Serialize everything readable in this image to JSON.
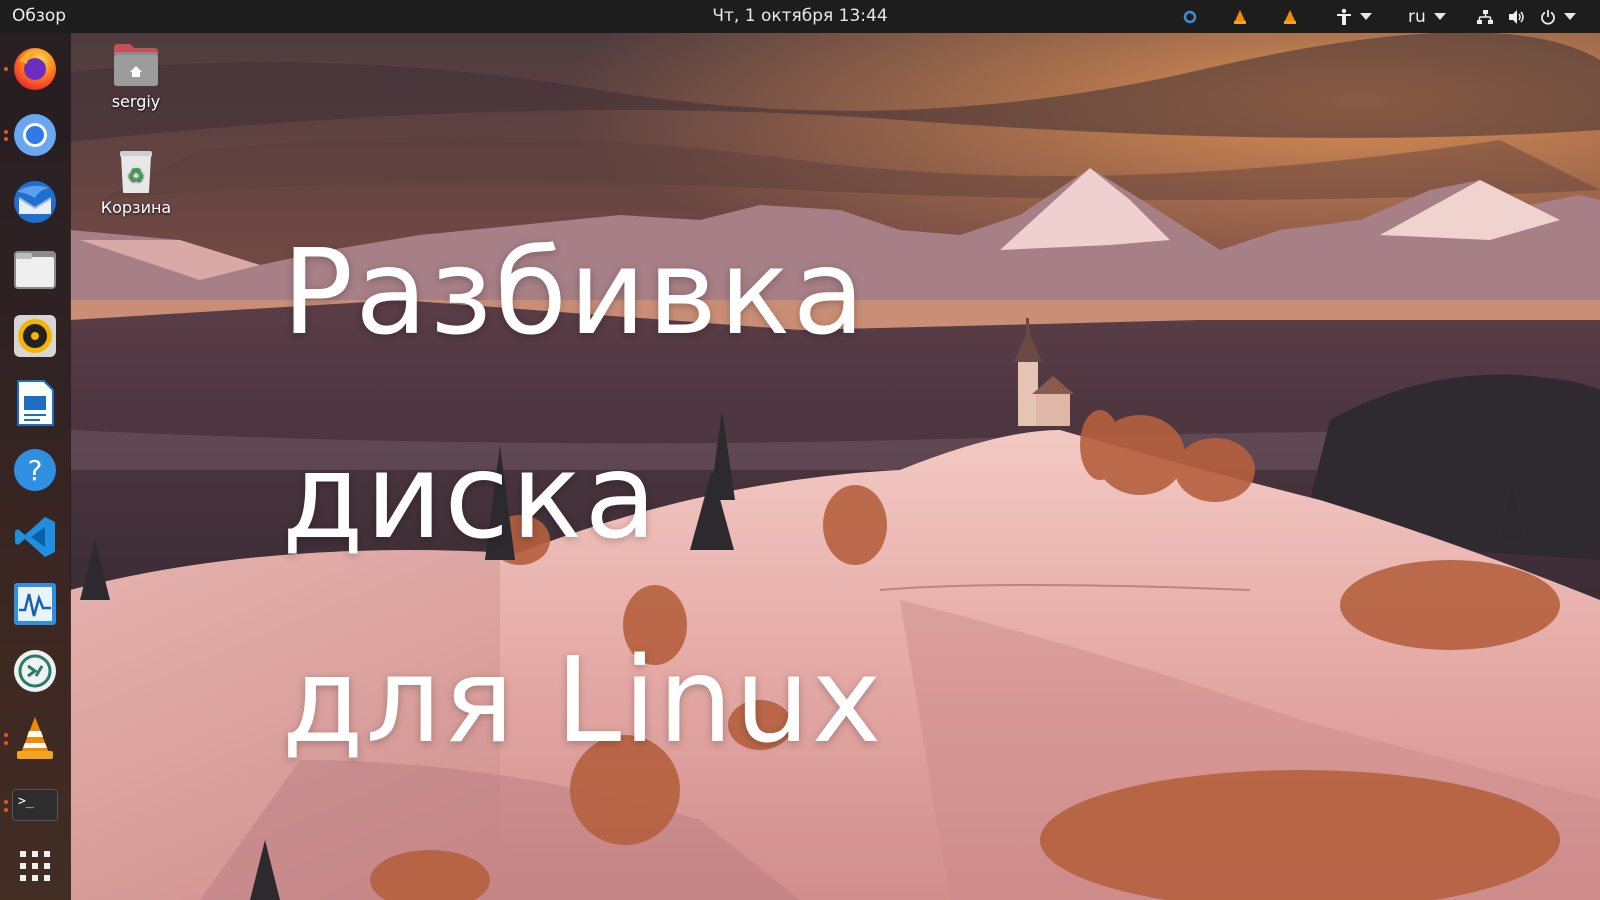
{
  "topbar": {
    "overview_label": "Обзор",
    "clock": "Чт, 1 октября  13:44",
    "language": "ru",
    "tray_icons": [
      "sync-icon",
      "vlc-tray-icon",
      "vlc-tray-icon",
      "accessibility-icon",
      "network-icon",
      "volume-icon",
      "power-icon"
    ]
  },
  "dock": {
    "apps": [
      {
        "name": "firefox",
        "icon": "firefox-icon",
        "running": true
      },
      {
        "name": "chromium",
        "icon": "chromium-icon",
        "running": true
      },
      {
        "name": "thunderbird",
        "icon": "thunderbird-icon",
        "running": false
      },
      {
        "name": "files",
        "icon": "files-icon",
        "running": false
      },
      {
        "name": "rhythmbox",
        "icon": "rhythmbox-icon",
        "running": false
      },
      {
        "name": "libreoffice-writer",
        "icon": "writer-icon",
        "running": false
      },
      {
        "name": "help",
        "icon": "help-icon",
        "running": false
      },
      {
        "name": "vscode",
        "icon": "vscode-icon",
        "running": false
      },
      {
        "name": "system-monitor",
        "icon": "system-monitor-icon",
        "running": false
      },
      {
        "name": "remote-desktop",
        "icon": "remote-desktop-icon",
        "running": false
      },
      {
        "name": "vlc",
        "icon": "vlc-icon",
        "running": true
      },
      {
        "name": "terminal",
        "icon": "terminal-icon",
        "running": true
      }
    ],
    "show_apps_icon": "app-grid-icon",
    "terminal_prompt": ">_"
  },
  "desktop": {
    "icons": [
      {
        "label": "sergiy",
        "icon": "home-folder-icon"
      },
      {
        "label": "Корзина",
        "icon": "trash-icon"
      }
    ]
  },
  "overlay": {
    "line1": "Разбивка диска",
    "line2": "для Linux"
  },
  "colors": {
    "accent": "#e95420",
    "topbar": "#1d1d1d",
    "dock": "#1e181c"
  }
}
